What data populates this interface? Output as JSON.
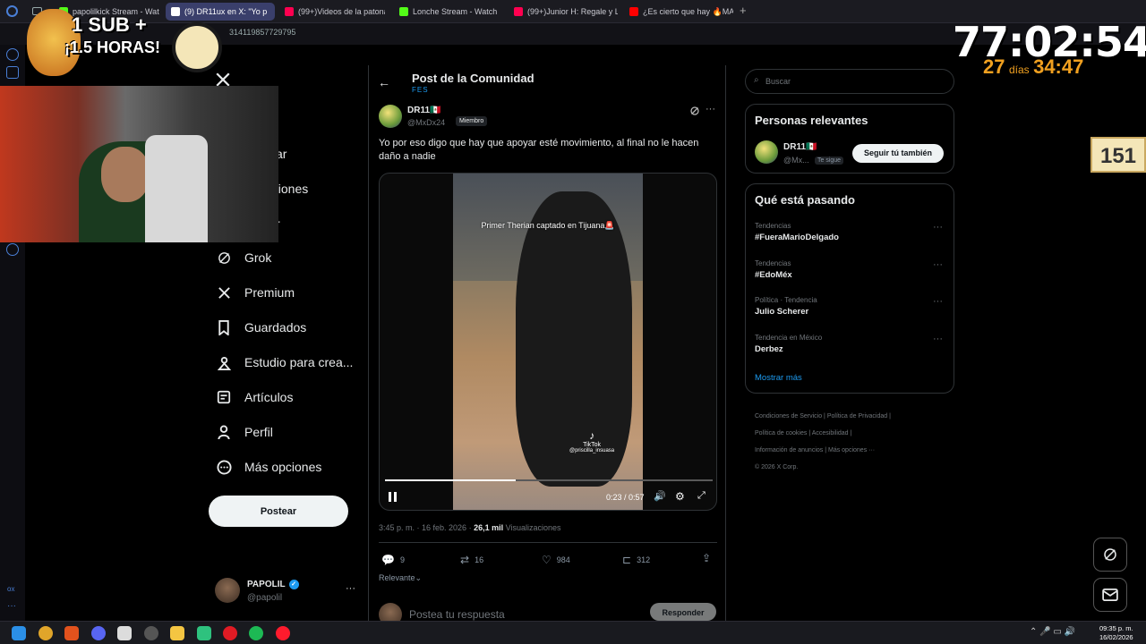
{
  "browser": {
    "tabs": [
      {
        "label": "papolilkick Stream - Watch",
        "color": "#53fc18"
      },
      {
        "label": "(9) DR11ux en X: \"Yo p",
        "color": "#ffffff",
        "active": true
      },
      {
        "label": "(99+)Videos de la patona",
        "color": "#ff0050"
      },
      {
        "label": "Lonche Stream - Watch L",
        "color": "#53fc18"
      },
      {
        "label": "(99+)Junior H: Regale y Li",
        "color": "#ff0050"
      },
      {
        "label": "¿Es cierto que hay 🔥MAD",
        "color": "#ff0000"
      }
    ],
    "url": "314119857729795"
  },
  "overlay": {
    "sub_line1": "1 SUB +",
    "sub_line2": "¡1.5 HORAS!",
    "timer": "77:02:54",
    "days_num": "27",
    "days_label": "días",
    "days_time": "34:47",
    "counter": "151"
  },
  "nav": {
    "items": [
      {
        "label": "Grok",
        "icon": "grok-icon"
      },
      {
        "label": "Premium",
        "icon": "x-icon"
      },
      {
        "label": "Guardados",
        "icon": "bookmark-icon"
      },
      {
        "label": "Estudio para crea...",
        "icon": "studio-icon"
      },
      {
        "label": "Artículos",
        "icon": "articles-icon"
      },
      {
        "label": "Perfil",
        "icon": "person-icon"
      },
      {
        "label": "Más opciones",
        "icon": "more-circle-icon"
      }
    ],
    "partial_items": [
      "ar",
      "aciones",
      "r"
    ],
    "post_button": "Postear",
    "account": {
      "name": "PAPOLIL",
      "handle": "@papolil"
    }
  },
  "post": {
    "header_title": "Post de la Comunidad",
    "header_sub": "FES",
    "author_name": "DR11🇲🇽",
    "author_handle": "@MxDx24",
    "author_badge": "Miembro",
    "text": "Yo por eso digo que hay que apoyar esté movimiento, al final no le hacen daño a nadie",
    "video": {
      "caption": "Primer Therian captado en Tijuana🚨",
      "watermark": "TikTok",
      "watermark_user": "@priscilla_insuasa",
      "time": "0:23 / 0:57",
      "progress": 0.4
    },
    "timestamp": "3:45 p. m. · 16 feb. 2026 ·",
    "views_count": "26,1 mil",
    "views_label": "Visualizaciones",
    "replies": "9",
    "reposts": "16",
    "likes": "984",
    "bookmarks": "312",
    "sort_label": "Relevante",
    "reply_placeholder": "Postea tu respuesta",
    "reply_button": "Responder"
  },
  "right": {
    "search_placeholder": "Buscar",
    "relevant_title": "Personas relevantes",
    "relevant_person": {
      "name": "DR11🇲🇽",
      "handle": "@Mx...",
      "badge": "Te sigue",
      "button": "Seguir tú también"
    },
    "trends_title": "Qué está pasando",
    "trends": [
      {
        "category": "Tendencias",
        "name": "#FueraMarioDelgado"
      },
      {
        "category": "Tendencias",
        "name": "#EdoMéx"
      },
      {
        "category": "Política · Tendencia",
        "name": "Julio Scherer"
      },
      {
        "category": "Tendencia en México",
        "name": "Derbez"
      }
    ],
    "show_more": "Mostrar más",
    "footer": [
      "Condiciones de Servicio",
      "Política de Privacidad",
      "Política de cookies",
      "Accesibilidad",
      "Información de anuncios",
      "Más opciones ···",
      "© 2026 X Corp."
    ]
  },
  "taskbar": {
    "time": "09:35 p. m.",
    "date": "16/02/2026"
  }
}
